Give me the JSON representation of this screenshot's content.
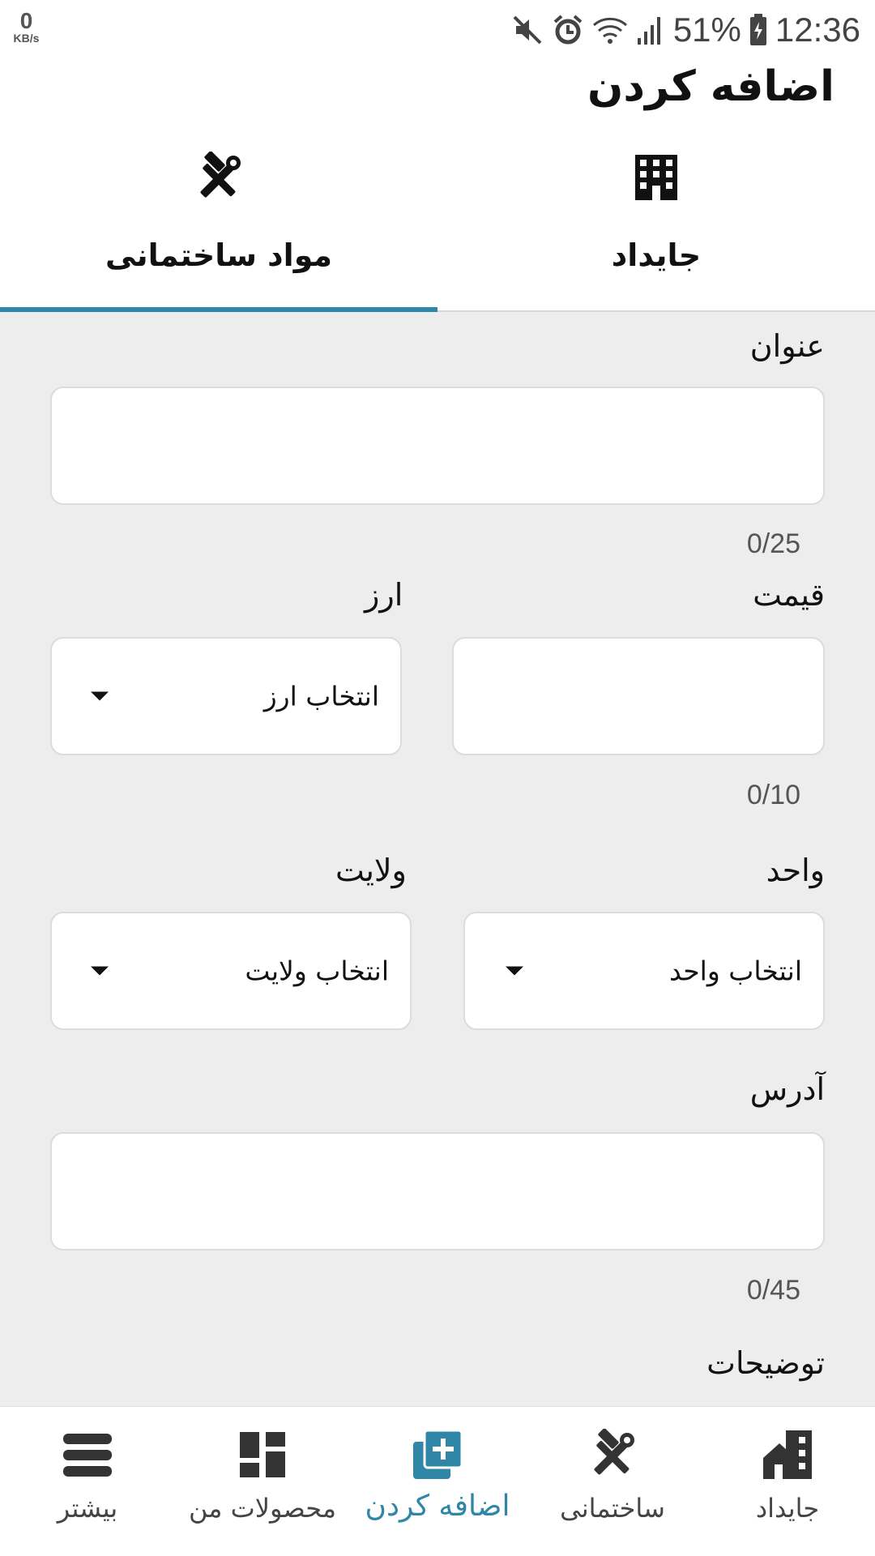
{
  "status_bar": {
    "net_speed": "0",
    "net_unit": "KB/s",
    "battery": "51%",
    "time": "12:36",
    "icons": [
      "mute-icon",
      "alarm-icon",
      "wifi-icon",
      "signal-icon",
      "battery-charging-icon"
    ]
  },
  "header": {
    "title": "اضافه کردن"
  },
  "tabs": [
    {
      "label": "مواد ساختمانی",
      "icon": "tools-icon",
      "selected": true
    },
    {
      "label": "جایداد",
      "icon": "building-icon",
      "selected": false
    }
  ],
  "form": {
    "title_label": "عنوان",
    "title_value": "",
    "title_counter": "0/25",
    "price_label": "قیمت",
    "price_value": "",
    "price_counter": "0/10",
    "currency_label": "ارز",
    "currency_select": "انتخاب ارز",
    "unit_label": "واحد",
    "unit_select": "انتخاب واحد",
    "province_label": "ولایت",
    "province_select": "انتخاب ولایت",
    "address_label": "آدرس",
    "address_value": "",
    "address_counter": "0/45",
    "description_label": "توضیحات"
  },
  "bottom_nav": [
    {
      "label": "بیشتر",
      "icon": "menu-icon"
    },
    {
      "label": "محصولات من",
      "icon": "dashboard-icon"
    },
    {
      "label": "اضافه کردن",
      "icon": "add-box-icon",
      "active": true
    },
    {
      "label": "ساختمانی",
      "icon": "tools-icon"
    },
    {
      "label": "جایداد",
      "icon": "house-building-icon"
    }
  ],
  "colors": {
    "accent": "#2f86a6",
    "background": "#ededed",
    "surface": "#ffffff"
  }
}
